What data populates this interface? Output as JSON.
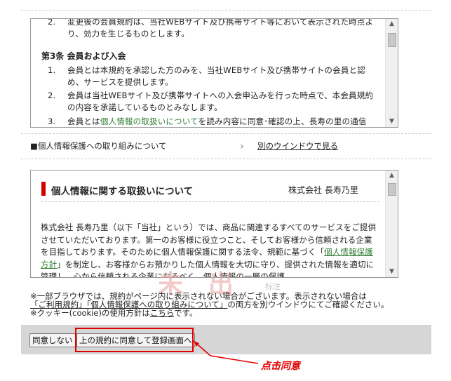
{
  "terms_box": {
    "item_2_1": {
      "num": "2.",
      "text": "変更後の会員規約は、当社WEBサイト及び携帯サイト等において表示された時点より、効力を生じるものとします。"
    },
    "section_title": "第3条 会員および入会",
    "item_3_1": {
      "num": "1.",
      "text": "会員とは本規約を承認した方のみを、当社WEBサイト及び携帯サイトの会員と認め、サービスを提供します。"
    },
    "item_3_2": {
      "num": "2.",
      "text": "会員は当社WEBサイト及び携帯サイトへの入会申込みを行った時点で、本会員規約の内容を承諾しているものとみなします。"
    },
    "item_3_3": {
      "num": "3.",
      "pre": "会員とは",
      "link": "個人情報の取扱いについて",
      "post": "を読み内容に同意･確認の上、長寿の里の通信"
    }
  },
  "privacy_row": {
    "label": "■個人情報保護への取り組みについて",
    "arrow": "›",
    "link": "別のウインドウで見る"
  },
  "privacy_box": {
    "title": "個人情報に関する取扱いについて",
    "company": "株式会社 長寿乃里",
    "body_pre": "株式会社 長寿乃里（以下「当社」という）では、商品に関連するすべてのサービスをご提供させていただいております。第一のお客様に役立つこと、そしてお客様から信頼される企業を目指しております。そのために個人情報保護に関する法令、規範に基づく「",
    "body_link": "個人情報保護方針",
    "body_post": "」を制定し、お客様からお預かりした個人情報を大切に守り、提供された情報を適切に管理し、心から信頼される企業になるべく、個人情報の一層の保護"
  },
  "notes": {
    "line1": "※一部ブラウザでは、規約がページ内に表示されない場合がございます。表示されない場合は",
    "line2_link": "「ご利用規約」「個人情報保護への取り組みについて」",
    "line2_post": "の両方を別ウインドウにてご確認ください。",
    "line3_pre": "※クッキー(cookie)の使用方針は",
    "line3_link": "こちら",
    "line3_post": "です。"
  },
  "watermark": {
    "chars": "未出",
    "small": "标注"
  },
  "buttons": {
    "disagree": "同意しない",
    "agree": "上の規約に同意して登録画面へ"
  },
  "annotation": "点击同意",
  "colors": {
    "highlight": "#e00000",
    "link_green": "#2e7d32",
    "title_bar": "#d40000"
  }
}
